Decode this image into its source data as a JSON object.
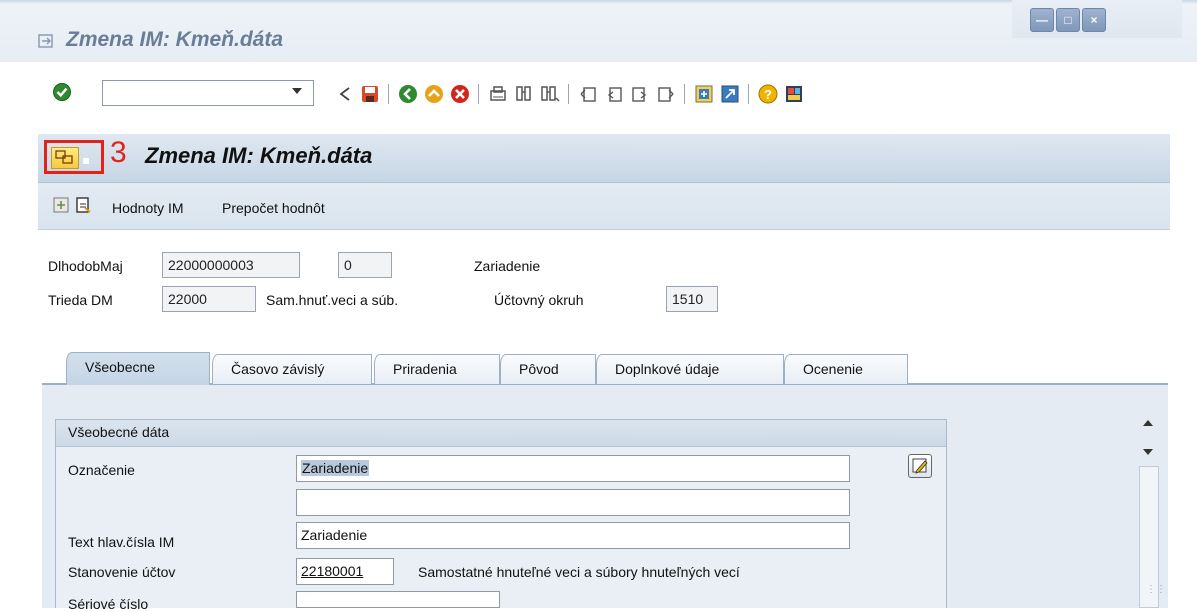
{
  "window": {
    "title": "Zmena IM: Kmeň.dáta",
    "controls": [
      "minimize-icon",
      "maximize-icon",
      "close-icon"
    ]
  },
  "toolbar": {
    "command_value": "",
    "icons": [
      "enter-icon",
      "back-arrow-icon",
      "save-icon",
      "back-icon",
      "exit-icon",
      "cancel-icon",
      "print-icon",
      "find-icon",
      "find-next-icon",
      "first-page-icon",
      "previous-page-icon",
      "next-page-icon",
      "last-page-icon",
      "create-session-icon",
      "shortcut-icon",
      "help-icon",
      "customize-layout-icon"
    ]
  },
  "app": {
    "title": "Zmena IM: Kmeň.dáta",
    "step_number": "3",
    "menu_icon": "system-menu-icon"
  },
  "app_toolbar": {
    "icons": [
      "other-asset-icon",
      "display-document-icon"
    ],
    "buttons": [
      "Hodnoty IM",
      "Prepočet hodnôt"
    ]
  },
  "header": {
    "asset_label": "DlhodobMaj",
    "asset_number": "22000000003",
    "sub_number": "0",
    "asset_description": "Zariadenie",
    "class_label": "Trieda DM",
    "class_value": "22000",
    "class_description": "Sam.hnuť.veci a súb.",
    "company_label": "Účtovný okruh",
    "company_value": "1510"
  },
  "tabs": [
    {
      "label": "Všeobecne",
      "active": true
    },
    {
      "label": "Časovo závislý",
      "active": false
    },
    {
      "label": "Priradenia",
      "active": false
    },
    {
      "label": "Pôvod",
      "active": false
    },
    {
      "label": "Doplnkové údaje",
      "active": false
    },
    {
      "label": "Ocenenie",
      "active": false
    }
  ],
  "general_data": {
    "title": "Všeobecné dáta",
    "description_label": "Označenie",
    "description_value": "Zariadenie",
    "description_value2": "",
    "main_text_label": "Text hlav.čísla IM",
    "main_text_value": "Zariadenie",
    "account_det_label": "Stanovenie účtov",
    "account_det_value": "22180001",
    "account_det_description": "Samostatné hnuteľné veci a súbory hnuteľných vecí",
    "serial_label": "Sériové číslo",
    "serial_value": ""
  },
  "colors": {
    "accent_red": "#e2231a",
    "title_blue": "#6a7d96",
    "header_bg": "#c7d6e5"
  }
}
